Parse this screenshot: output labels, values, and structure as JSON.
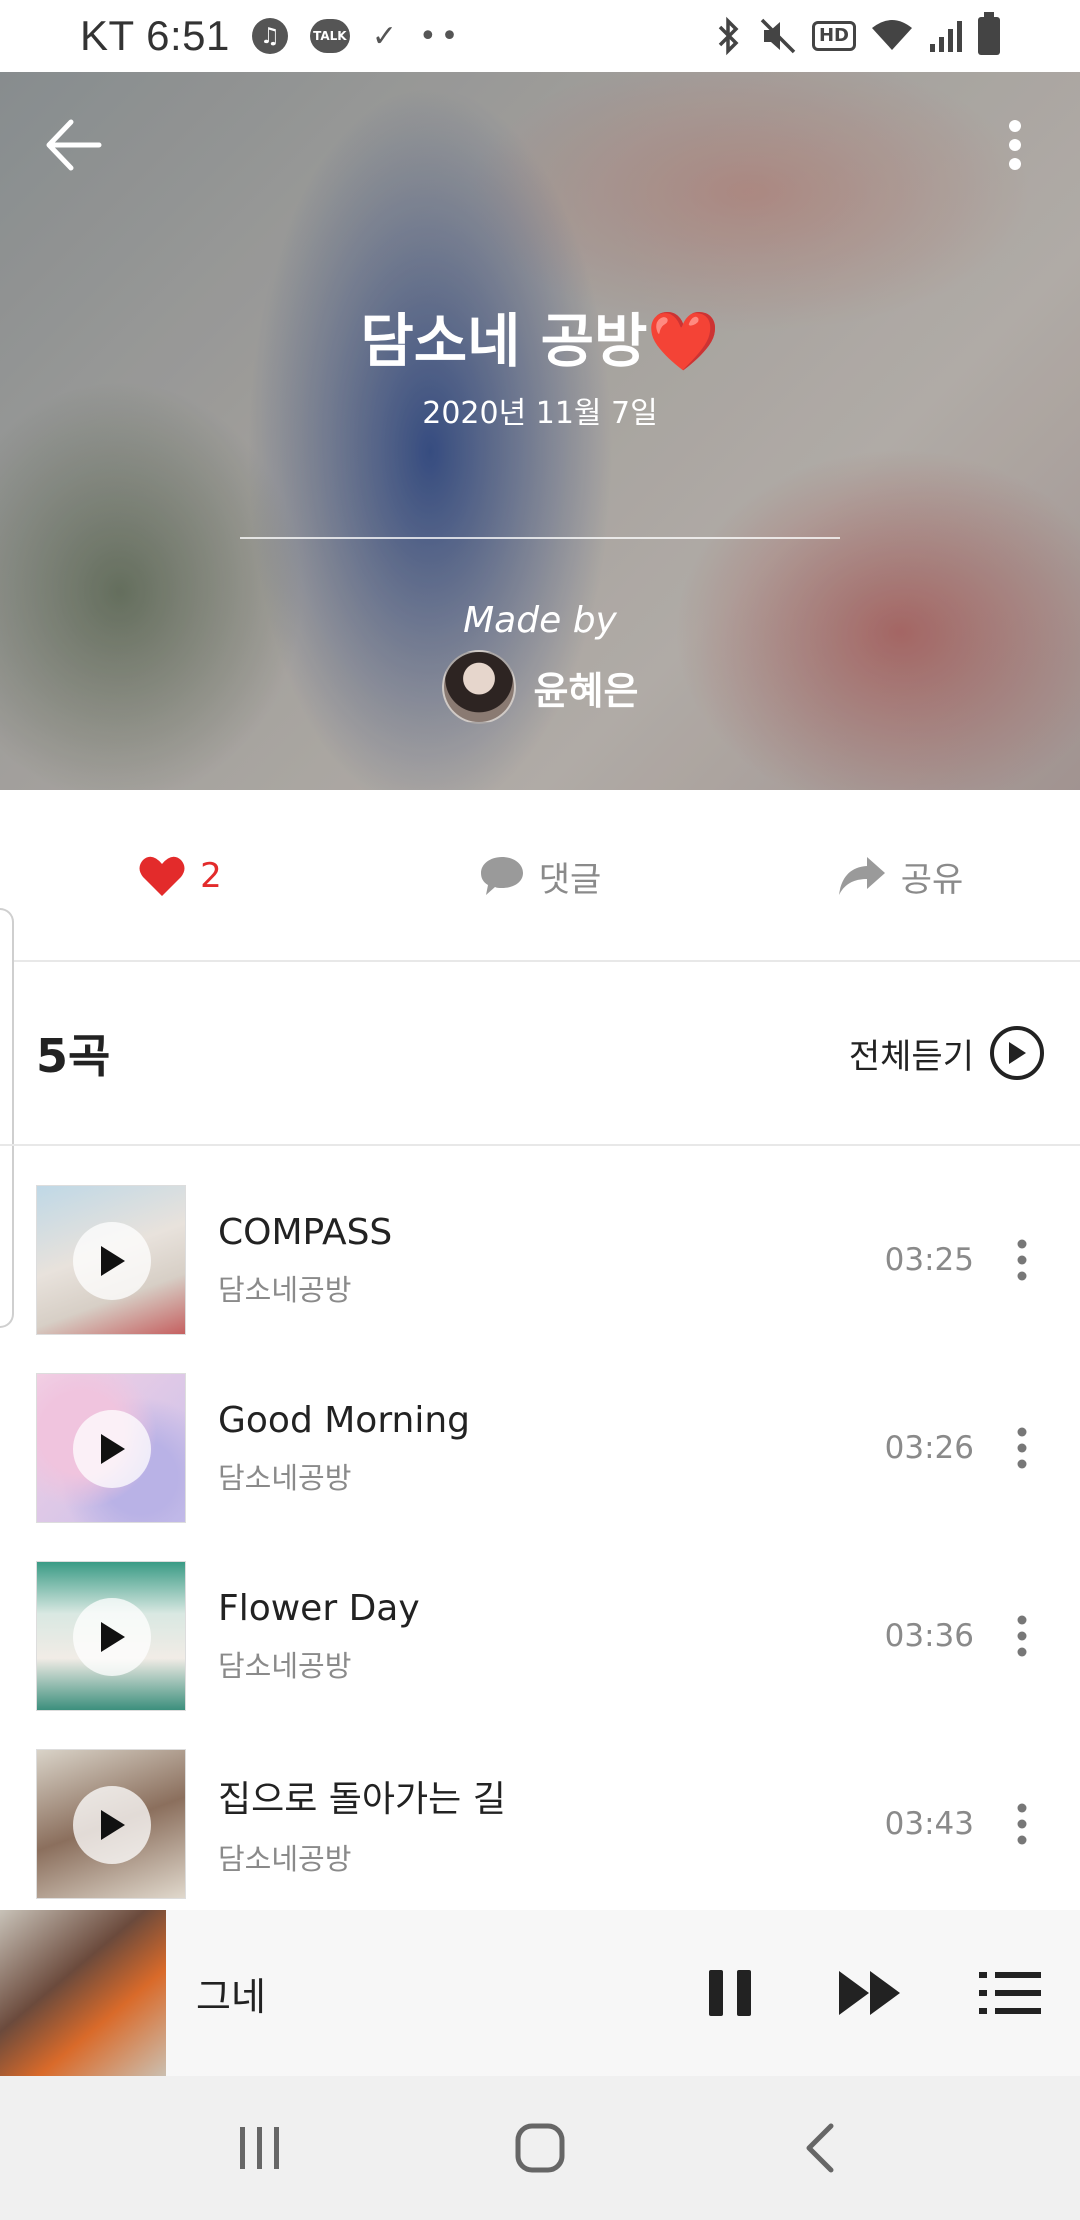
{
  "status_bar": {
    "time": "KT 6:51",
    "talk_label": "TALK",
    "hd_label": "HD"
  },
  "playlist": {
    "title": "담소네 공방❤️",
    "date": "2020년 11월 7일",
    "made_by_label": "Made by",
    "creator_name": "윤혜은"
  },
  "actions": {
    "like_count": "2",
    "comment_label": "댓글",
    "share_label": "공유"
  },
  "list_header": {
    "count_label": "5곡",
    "play_all_label": "전체듣기"
  },
  "songs": [
    {
      "title": "COMPASS",
      "artist": "담소네공방",
      "duration": "03:25"
    },
    {
      "title": "Good Morning",
      "artist": "담소네공방",
      "duration": "03:26"
    },
    {
      "title": "Flower Day",
      "artist": "담소네공방",
      "duration": "03:36"
    },
    {
      "title": "집으로 돌아가는 길",
      "artist": "담소네공방",
      "duration": "03:43"
    }
  ],
  "now_playing": {
    "title": "그네"
  },
  "colors": {
    "like_red": "#e32b2b",
    "text_gray": "#8a8a8a",
    "player_bg": "#f7f7f7",
    "nav_bg": "#f0f0f0"
  }
}
